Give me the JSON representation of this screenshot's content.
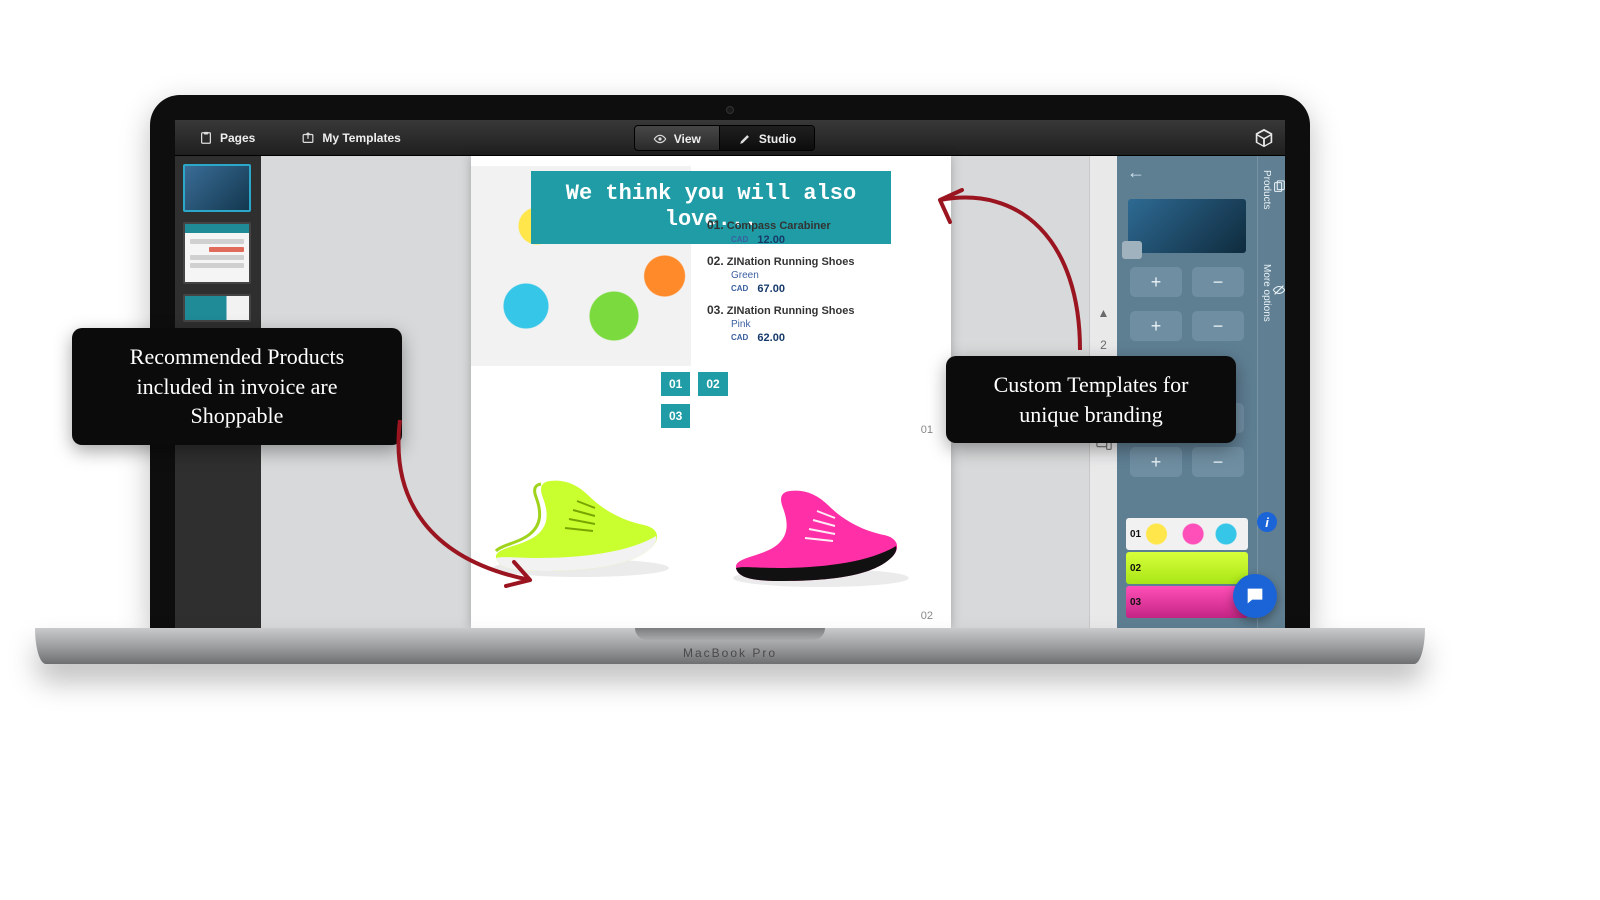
{
  "toolbar": {
    "pages": "Pages",
    "templates": "My Templates",
    "view": "View",
    "studio": "Studio"
  },
  "banner": "We think you will also love...",
  "products": [
    {
      "num": "01.",
      "name": "Compass Carabiner",
      "color": "",
      "currency": "CAD",
      "price": "12.00"
    },
    {
      "num": "02.",
      "name": "ZINation Running Shoes",
      "color": "Green",
      "currency": "CAD",
      "price": "67.00"
    },
    {
      "num": "03.",
      "name": "ZINation Running Shoes",
      "color": "Pink",
      "currency": "CAD",
      "price": "62.00"
    }
  ],
  "chips": [
    "01",
    "02",
    "03"
  ],
  "canvas_labels": {
    "tag1": "01",
    "tag2": "02"
  },
  "rail": {
    "page_num": "2"
  },
  "right_tabs": {
    "products": "Products",
    "more": "More options"
  },
  "variant_labels": {
    "v1": "01",
    "v2": "02",
    "v3": "03"
  },
  "info_glyph": "i",
  "laptop_label": "MacBook Pro",
  "callouts": {
    "left": "Recommended Products included in invoice are Shoppable",
    "right": "Custom Templates for unique branding"
  }
}
